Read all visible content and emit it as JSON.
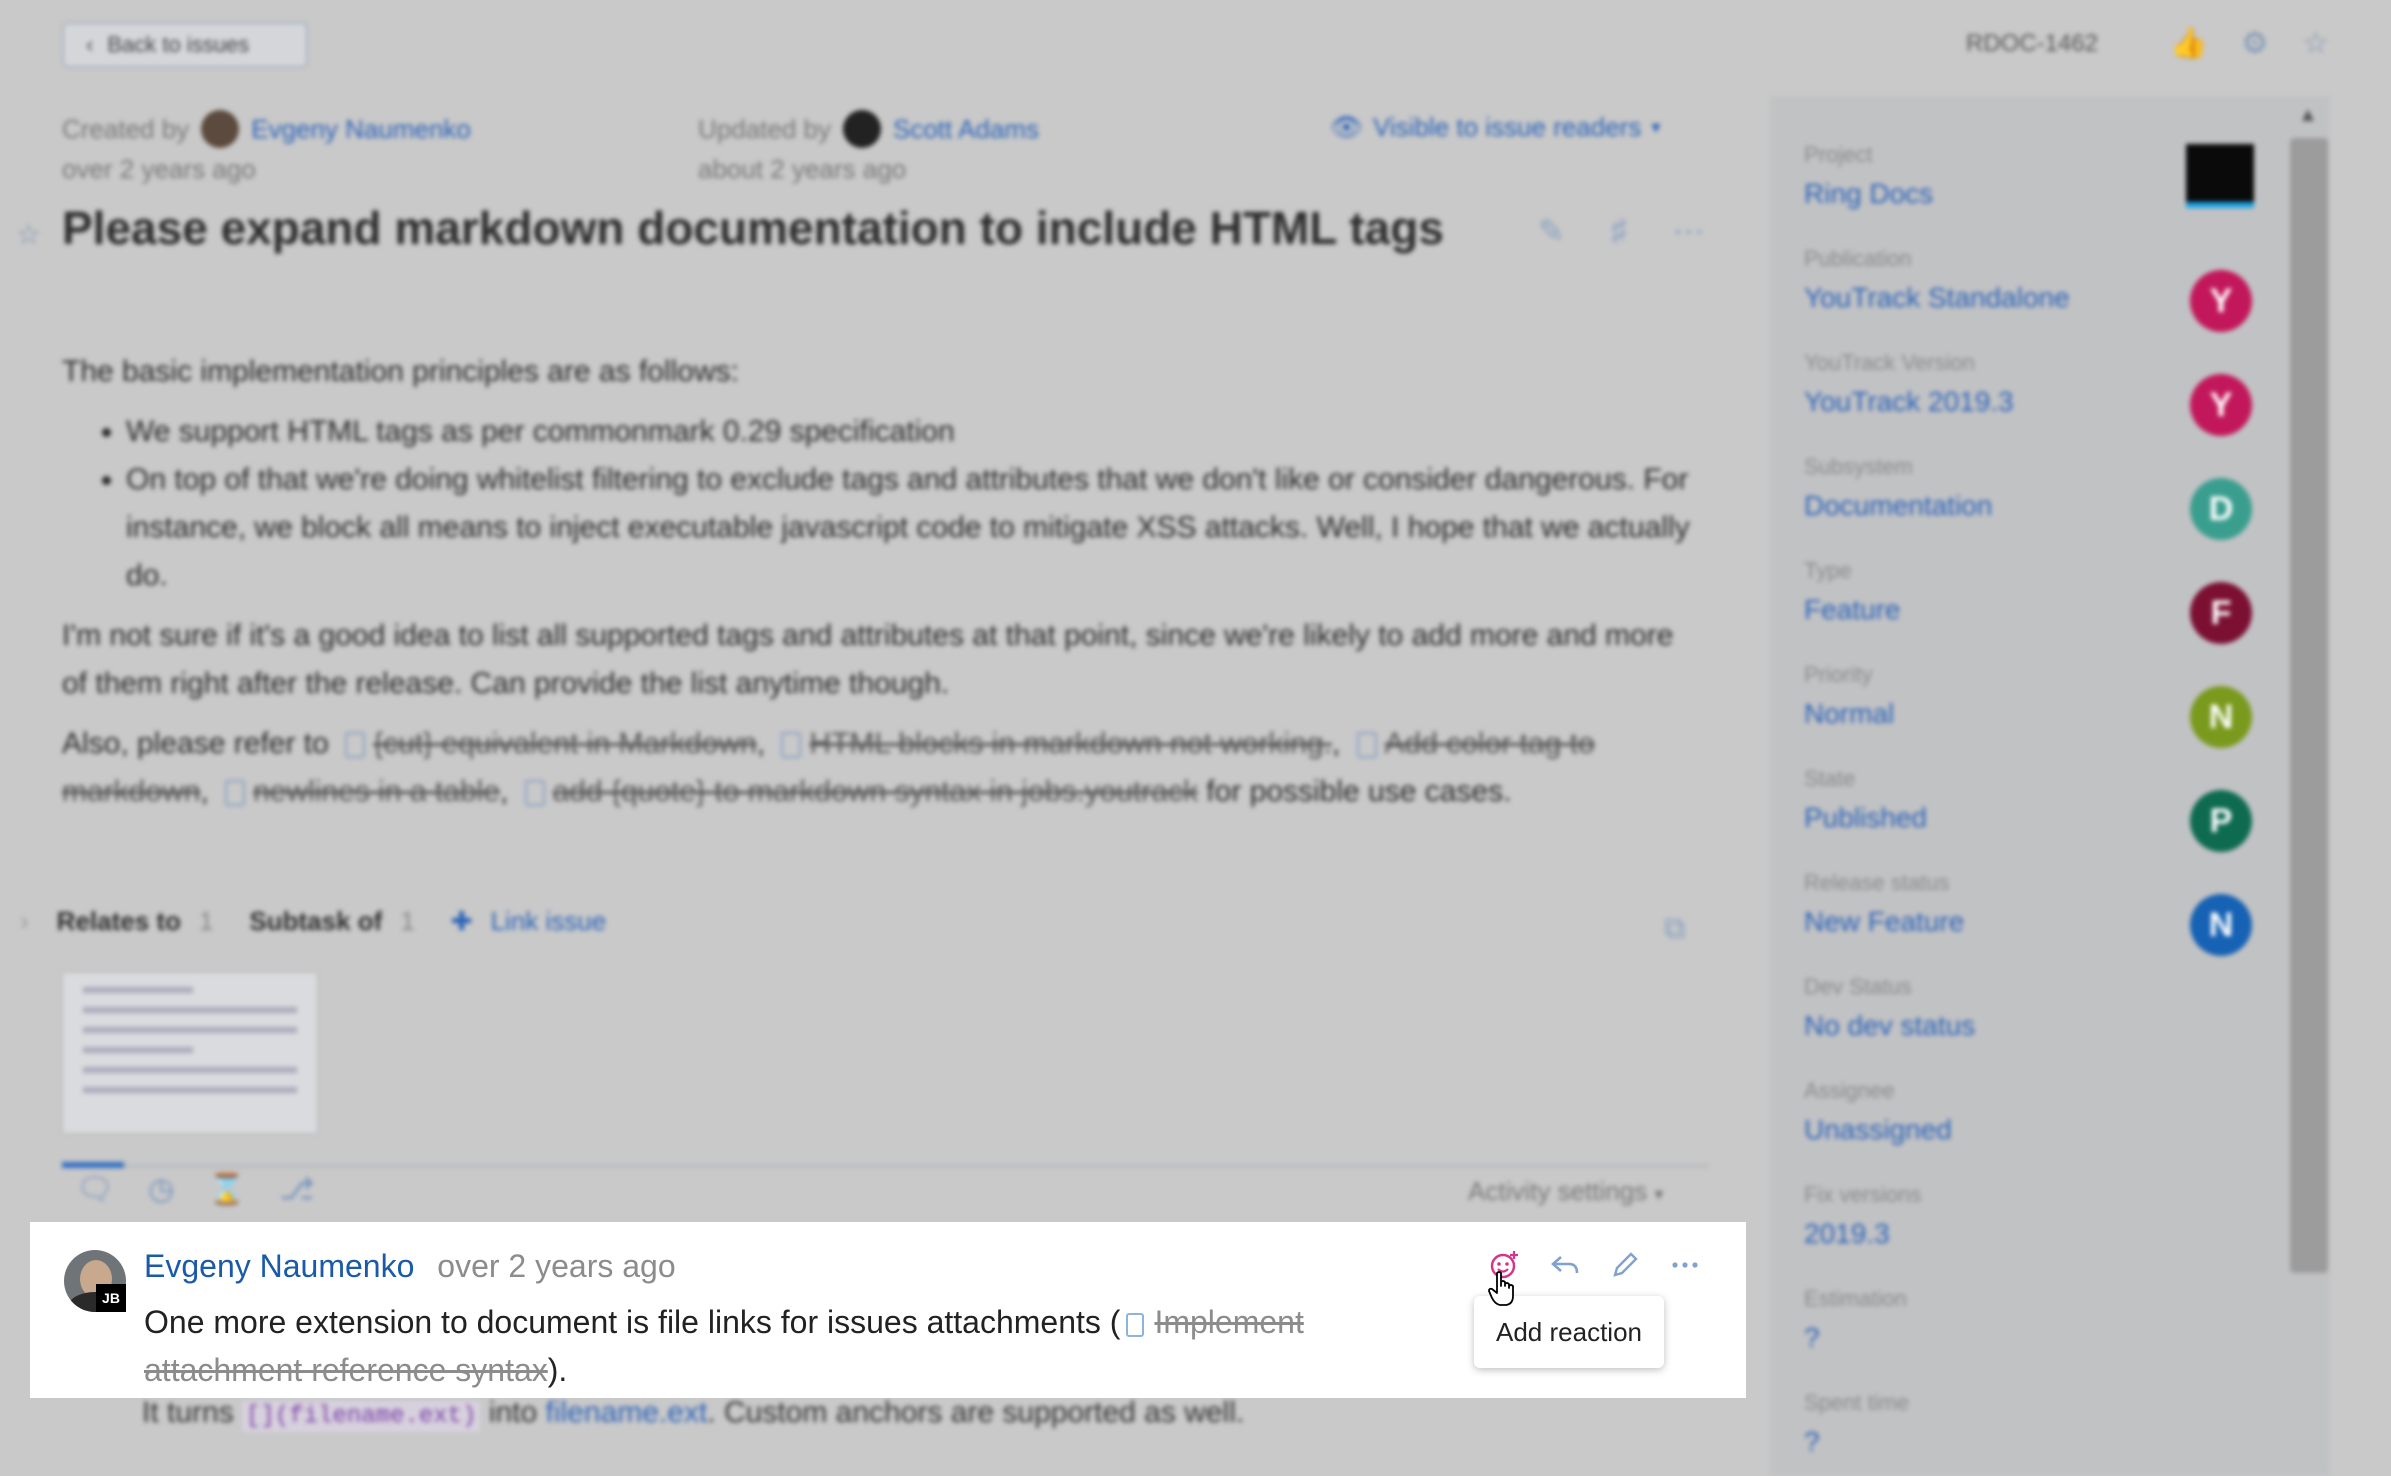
{
  "topbar": {
    "back_label": "Back to issues",
    "issue_id": "RDOC-1462"
  },
  "meta": {
    "created_label": "Created by",
    "created_author": "Evgeny Naumenko",
    "created_time": "over 2 years ago",
    "updated_label": "Updated by",
    "updated_author": "Scott Adams",
    "updated_time": "about 2 years ago",
    "visibility": "Visible to issue readers"
  },
  "issue": {
    "title": "Please expand markdown documentation to include HTML tags",
    "intro": "The basic implementation principles are as follows:",
    "bullets": [
      "We support HTML tags as per commonmark 0.29 specification",
      "On top of that we're doing whitelist filtering to exclude tags and attributes that we don't like or consider dangerous. For instance, we block all means to inject executable javascript code to mitigate XSS attacks. Well, I hope that we actually do."
    ],
    "para2": "I'm not sure if it's a good idea to list all supported tags and attributes at that point, since we're likely to add more and more of them right after the release. Can provide the list anytime though.",
    "para3_prefix": "Also, please refer to",
    "para3_links": [
      "{cut} equivalent in Markdown",
      "HTML blocks in markdown not working.",
      "Add color tag to markdown",
      "newlines in a table",
      "add {quote} to markdown syntax in jobs.youtrack"
    ],
    "para3_suffix": "for possible use cases."
  },
  "links": {
    "relates_label": "Relates to",
    "relates_count": "1",
    "subtask_label": "Subtask of",
    "subtask_count": "1",
    "link_issue": "Link issue"
  },
  "activity": {
    "settings_label": "Activity settings"
  },
  "comment": {
    "author": "Evgeny Naumenko",
    "time": "over 2 years ago",
    "text_prefix": "One more extension to document is file links for issues attachments (",
    "linked_issue": "Implement attachment reference syntax",
    "text_suffix": ").",
    "badge": "JB",
    "tooltip": "Add reaction"
  },
  "next_line": {
    "prefix": "It turns",
    "code": "[](filename.ext)",
    "middle": "into",
    "link": "filename.ext",
    "suffix": ". Custom anchors are supported as well."
  },
  "sidebar": {
    "fields": [
      {
        "label": "Project",
        "value": "Ring Docs",
        "badge": "",
        "color": "#0a0a0a"
      },
      {
        "label": "Publication",
        "value": "YouTrack Standalone",
        "badge": "Y",
        "color": "#c2185b"
      },
      {
        "label": "YouTrack Version",
        "value": "YouTrack 2019.3",
        "badge": "Y",
        "color": "#c2185b"
      },
      {
        "label": "Subsystem",
        "value": "Documentation",
        "badge": "D",
        "color": "#3a9e8f"
      },
      {
        "label": "Type",
        "value": "Feature",
        "badge": "F",
        "color": "#7b1033"
      },
      {
        "label": "Priority",
        "value": "Normal",
        "badge": "N",
        "color": "#7a9a1d"
      },
      {
        "label": "State",
        "value": "Published",
        "badge": "P",
        "color": "#0e6b50"
      },
      {
        "label": "Release status",
        "value": "New Feature",
        "badge": "N",
        "color": "#1662b4"
      },
      {
        "label": "Dev Status",
        "value": "No dev status",
        "badge": "",
        "color": ""
      },
      {
        "label": "Assignee",
        "value": "Unassigned",
        "badge": "",
        "color": ""
      },
      {
        "label": "Fix versions",
        "value": "2019.3",
        "badge": "",
        "color": ""
      },
      {
        "label": "Estimation",
        "value": "?",
        "badge": "",
        "color": ""
      },
      {
        "label": "Spent time",
        "value": "?",
        "badge": "",
        "color": ""
      }
    ]
  },
  "colors": {
    "accent": "#2a62b8",
    "reaction_icon": "#d6338a",
    "action_icons": "#7fa2cf"
  }
}
